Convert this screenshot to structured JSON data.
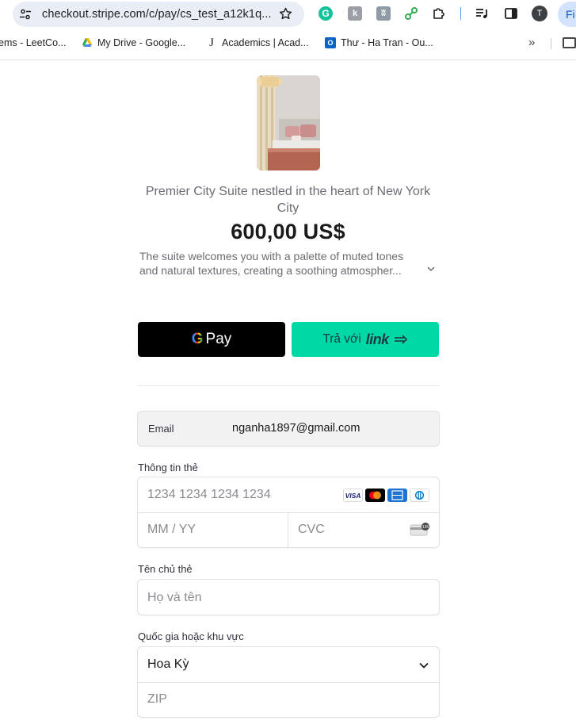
{
  "browser": {
    "url": "checkout.stripe.com/c/pay/cs_test_a12k1q...",
    "avatar_letter": "T",
    "side_button_label": "Fi",
    "extensions": [
      "grammarly-icon",
      "kami-icon",
      "butterfly-icon",
      "link-icon",
      "puzzle-icon",
      "media-icon",
      "sidepanel-icon"
    ],
    "bookmarks": [
      {
        "label": "ems - LeetCo...",
        "icon": "leetcode-icon"
      },
      {
        "label": "My Drive - Google...",
        "icon": "google-drive-icon"
      },
      {
        "label": "Academics | Acad...",
        "icon": "journal-icon"
      },
      {
        "label": "Thư - Ha Tran - Ou...",
        "icon": "outlook-icon"
      }
    ],
    "bookmarks_more": "»"
  },
  "product": {
    "name": "Premier City Suite nestled in the heart of New York City",
    "price": "600,00 US$",
    "description_line1": "The suite welcomes you with a palette of muted tones",
    "description_line2": "and natural textures, creating a soothing atmospher..."
  },
  "buttons": {
    "gpay_g": "G",
    "gpay_label": "Pay",
    "link_prefix": "Trả với",
    "link_word": "link"
  },
  "form": {
    "email_label": "Email",
    "email_value": "nganha1897@gmail.com",
    "card_label": "Thông tin thẻ",
    "card_number_placeholder": "1234 1234 1234 1234",
    "expiry_placeholder": "MM / YY",
    "cvc_placeholder": "CVC",
    "card_brands": [
      "visa",
      "mastercard",
      "amex",
      "diners"
    ],
    "visa_text": "VISA",
    "cvc_badge": "135",
    "cardholder_label": "Tên chủ thẻ",
    "cardholder_placeholder": "Họ và tên",
    "country_label": "Quốc gia hoặc khu vực",
    "country_value": "Hoa Kỳ",
    "zip_placeholder": "ZIP"
  }
}
